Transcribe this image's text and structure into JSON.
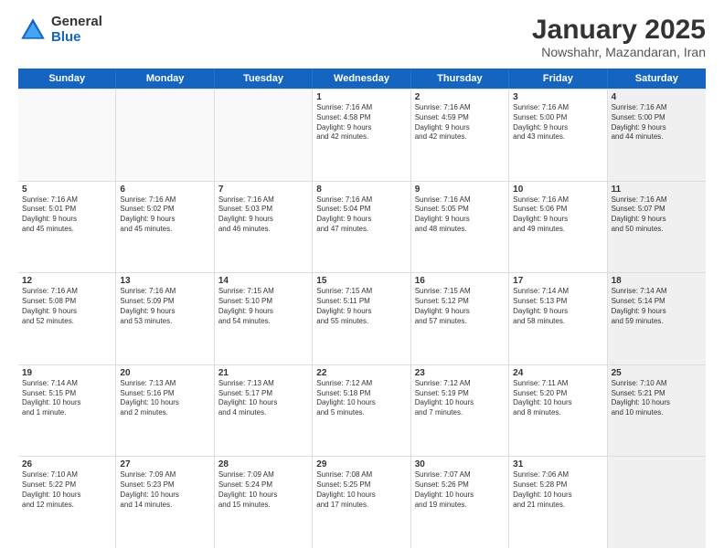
{
  "logo": {
    "general": "General",
    "blue": "Blue"
  },
  "title": "January 2025",
  "subtitle": "Nowshahr, Mazandaran, Iran",
  "days": [
    "Sunday",
    "Monday",
    "Tuesday",
    "Wednesday",
    "Thursday",
    "Friday",
    "Saturday"
  ],
  "rows": [
    [
      {
        "day": "",
        "text": "",
        "empty": true
      },
      {
        "day": "",
        "text": "",
        "empty": true
      },
      {
        "day": "",
        "text": "",
        "empty": true
      },
      {
        "day": "1",
        "text": "Sunrise: 7:16 AM\nSunset: 4:58 PM\nDaylight: 9 hours\nand 42 minutes."
      },
      {
        "day": "2",
        "text": "Sunrise: 7:16 AM\nSunset: 4:59 PM\nDaylight: 9 hours\nand 42 minutes."
      },
      {
        "day": "3",
        "text": "Sunrise: 7:16 AM\nSunset: 5:00 PM\nDaylight: 9 hours\nand 43 minutes."
      },
      {
        "day": "4",
        "text": "Sunrise: 7:16 AM\nSunset: 5:00 PM\nDaylight: 9 hours\nand 44 minutes.",
        "shaded": true
      }
    ],
    [
      {
        "day": "5",
        "text": "Sunrise: 7:16 AM\nSunset: 5:01 PM\nDaylight: 9 hours\nand 45 minutes."
      },
      {
        "day": "6",
        "text": "Sunrise: 7:16 AM\nSunset: 5:02 PM\nDaylight: 9 hours\nand 45 minutes."
      },
      {
        "day": "7",
        "text": "Sunrise: 7:16 AM\nSunset: 5:03 PM\nDaylight: 9 hours\nand 46 minutes."
      },
      {
        "day": "8",
        "text": "Sunrise: 7:16 AM\nSunset: 5:04 PM\nDaylight: 9 hours\nand 47 minutes."
      },
      {
        "day": "9",
        "text": "Sunrise: 7:16 AM\nSunset: 5:05 PM\nDaylight: 9 hours\nand 48 minutes."
      },
      {
        "day": "10",
        "text": "Sunrise: 7:16 AM\nSunset: 5:06 PM\nDaylight: 9 hours\nand 49 minutes."
      },
      {
        "day": "11",
        "text": "Sunrise: 7:16 AM\nSunset: 5:07 PM\nDaylight: 9 hours\nand 50 minutes.",
        "shaded": true
      }
    ],
    [
      {
        "day": "12",
        "text": "Sunrise: 7:16 AM\nSunset: 5:08 PM\nDaylight: 9 hours\nand 52 minutes."
      },
      {
        "day": "13",
        "text": "Sunrise: 7:16 AM\nSunset: 5:09 PM\nDaylight: 9 hours\nand 53 minutes."
      },
      {
        "day": "14",
        "text": "Sunrise: 7:15 AM\nSunset: 5:10 PM\nDaylight: 9 hours\nand 54 minutes."
      },
      {
        "day": "15",
        "text": "Sunrise: 7:15 AM\nSunset: 5:11 PM\nDaylight: 9 hours\nand 55 minutes."
      },
      {
        "day": "16",
        "text": "Sunrise: 7:15 AM\nSunset: 5:12 PM\nDaylight: 9 hours\nand 57 minutes."
      },
      {
        "day": "17",
        "text": "Sunrise: 7:14 AM\nSunset: 5:13 PM\nDaylight: 9 hours\nand 58 minutes."
      },
      {
        "day": "18",
        "text": "Sunrise: 7:14 AM\nSunset: 5:14 PM\nDaylight: 9 hours\nand 59 minutes.",
        "shaded": true
      }
    ],
    [
      {
        "day": "19",
        "text": "Sunrise: 7:14 AM\nSunset: 5:15 PM\nDaylight: 10 hours\nand 1 minute."
      },
      {
        "day": "20",
        "text": "Sunrise: 7:13 AM\nSunset: 5:16 PM\nDaylight: 10 hours\nand 2 minutes."
      },
      {
        "day": "21",
        "text": "Sunrise: 7:13 AM\nSunset: 5:17 PM\nDaylight: 10 hours\nand 4 minutes."
      },
      {
        "day": "22",
        "text": "Sunrise: 7:12 AM\nSunset: 5:18 PM\nDaylight: 10 hours\nand 5 minutes."
      },
      {
        "day": "23",
        "text": "Sunrise: 7:12 AM\nSunset: 5:19 PM\nDaylight: 10 hours\nand 7 minutes."
      },
      {
        "day": "24",
        "text": "Sunrise: 7:11 AM\nSunset: 5:20 PM\nDaylight: 10 hours\nand 8 minutes."
      },
      {
        "day": "25",
        "text": "Sunrise: 7:10 AM\nSunset: 5:21 PM\nDaylight: 10 hours\nand 10 minutes.",
        "shaded": true
      }
    ],
    [
      {
        "day": "26",
        "text": "Sunrise: 7:10 AM\nSunset: 5:22 PM\nDaylight: 10 hours\nand 12 minutes."
      },
      {
        "day": "27",
        "text": "Sunrise: 7:09 AM\nSunset: 5:23 PM\nDaylight: 10 hours\nand 14 minutes."
      },
      {
        "day": "28",
        "text": "Sunrise: 7:09 AM\nSunset: 5:24 PM\nDaylight: 10 hours\nand 15 minutes."
      },
      {
        "day": "29",
        "text": "Sunrise: 7:08 AM\nSunset: 5:25 PM\nDaylight: 10 hours\nand 17 minutes."
      },
      {
        "day": "30",
        "text": "Sunrise: 7:07 AM\nSunset: 5:26 PM\nDaylight: 10 hours\nand 19 minutes."
      },
      {
        "day": "31",
        "text": "Sunrise: 7:06 AM\nSunset: 5:28 PM\nDaylight: 10 hours\nand 21 minutes."
      },
      {
        "day": "",
        "text": "",
        "empty": true,
        "shaded": true
      }
    ]
  ]
}
